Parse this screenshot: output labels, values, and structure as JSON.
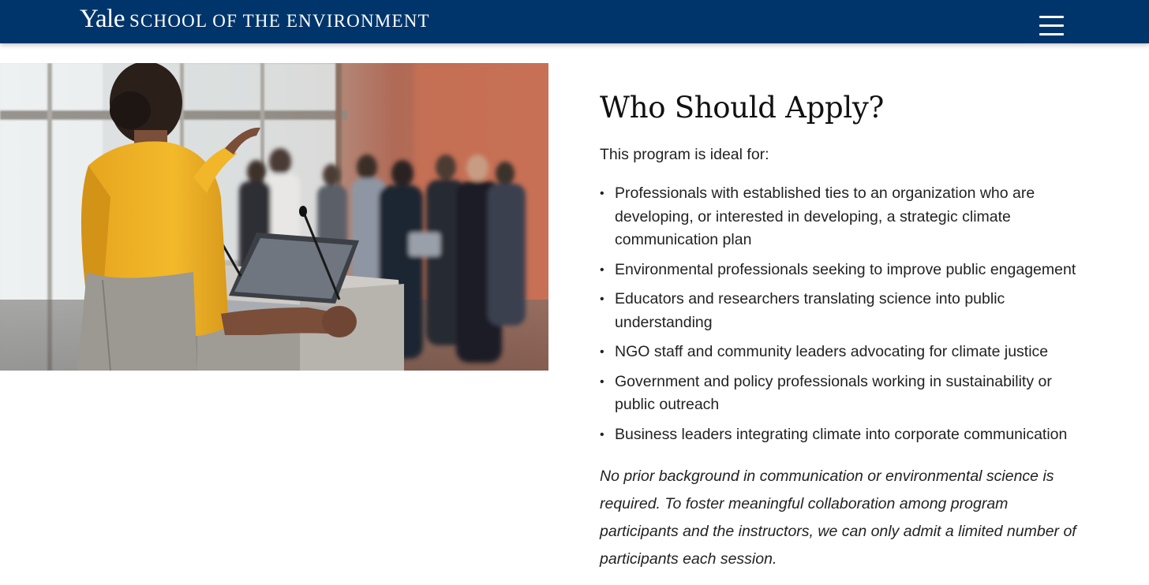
{
  "header": {
    "logo_primary": "Yale",
    "logo_secondary": "SCHOOL OF THE ENVIRONMENT",
    "menu_icon": "hamburger-menu-icon",
    "background_color": "#00356b"
  },
  "hero_image": {
    "subject": "speaker-at-podium-photo",
    "description_icon": "photo"
  },
  "section": {
    "heading": "Who Should Apply?",
    "intro": "This program is ideal for:",
    "bullets": [
      "Professionals with established ties to an organization who are developing, or interested in developing, a strategic climate communication plan",
      "Environmental professionals seeking to improve public engagement",
      "Educators and researchers translating science into public understanding",
      "NGO staff and community leaders advocating for climate justice",
      "Government and policy professionals working in sustainability or public outreach",
      "Business leaders integrating climate into corporate communication"
    ],
    "note": "No prior background in communication or environmental science is required. To foster meaningful collaboration among program participants and the instructors, we can only admit a limited number of participants each session."
  }
}
